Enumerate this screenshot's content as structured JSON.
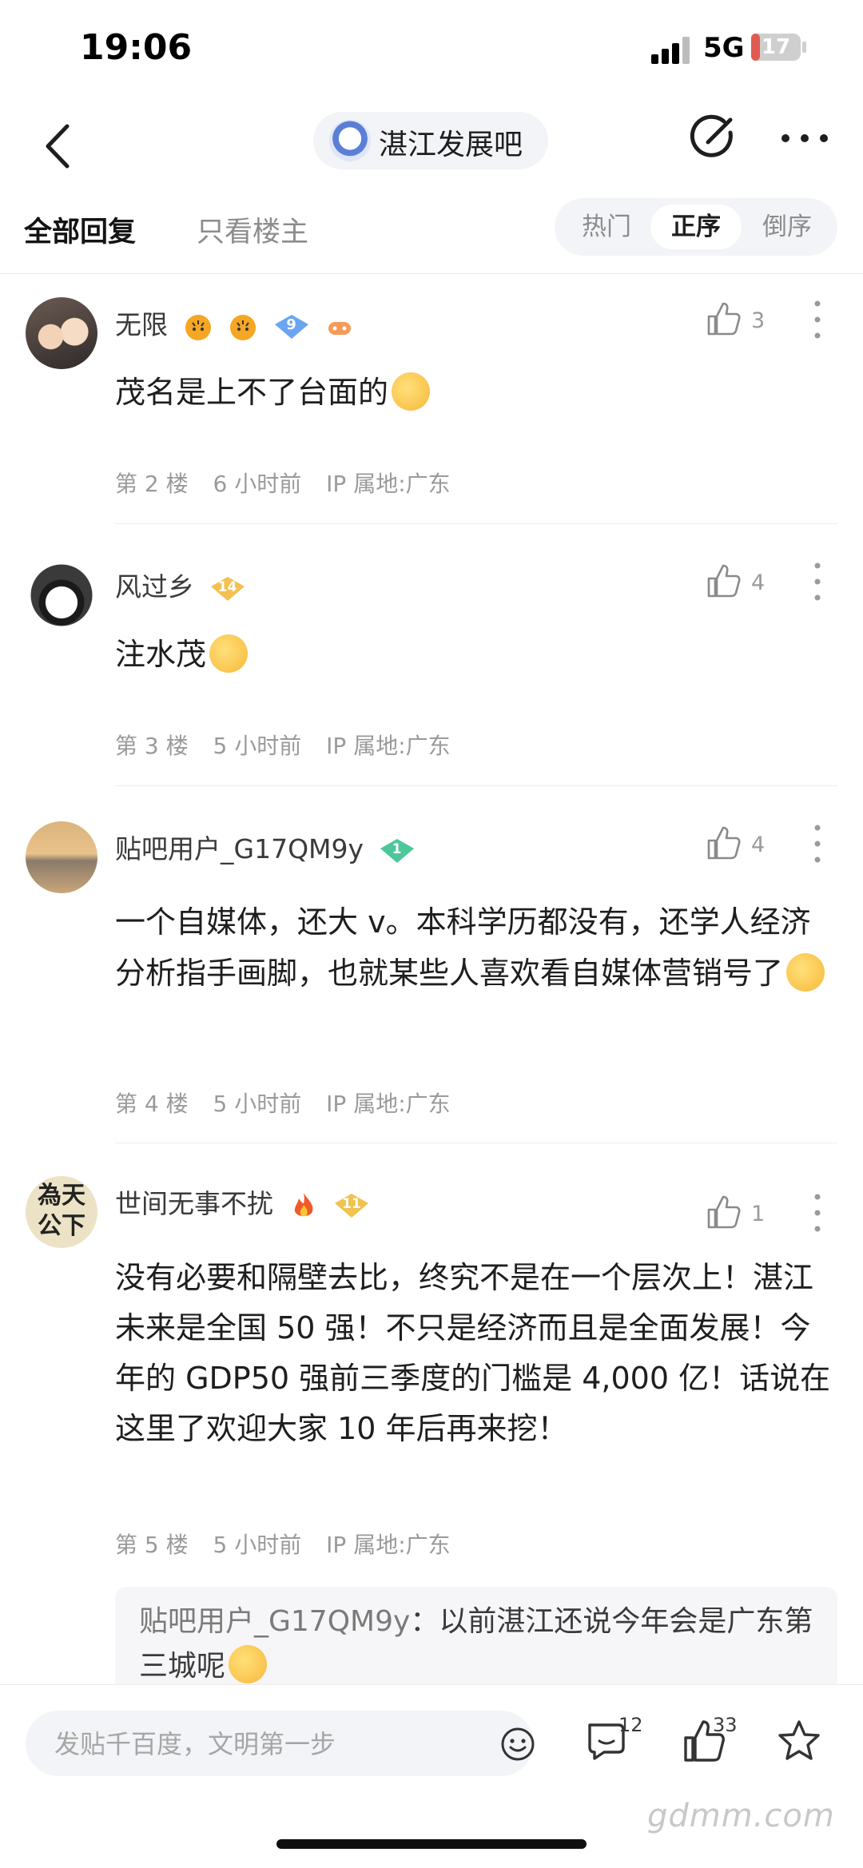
{
  "status_bar": {
    "time": "19:06",
    "network": "5G",
    "battery": "17",
    "battery_level": 0.17
  },
  "nav": {
    "forum_name": "湛江发展吧"
  },
  "tabs": {
    "all": "全部回复",
    "owner_only": "只看楼主"
  },
  "sort": {
    "hot": "热门",
    "asc": "正序",
    "desc": "倒序",
    "selected": "正序"
  },
  "posts": [
    {
      "username": "无限",
      "level": "9",
      "likes": "3",
      "content": "茂名是上不了台面的",
      "floor": "第 2 楼",
      "time": "6 小时前",
      "ip": "IP 属地:广东"
    },
    {
      "username": "风过乡",
      "level": "14",
      "likes": "4",
      "content": "注水茂",
      "floor": "第 3 楼",
      "time": "5 小时前",
      "ip": "IP 属地:广东"
    },
    {
      "username": "贴吧用户_G17QM9y",
      "level": "1",
      "likes": "4",
      "content": "一个自媒体，还大 v。本科学历都没有，还学人经济分析指手画脚，也就某些人喜欢看自媒体营销号了",
      "floor": "第 4 楼",
      "time": "5 小时前",
      "ip": "IP 属地:广东"
    },
    {
      "username": "世间无事不扰",
      "level": "11",
      "likes": "1",
      "content": "没有必要和隔壁去比，终究不是在一个层次上！湛江未来是全国 50 强！不只是经济而且是全面发展！今年的 GDP50 强前三季度的门槛是 4,000 亿！话说在这里了欢迎大家 10 年后再来挖！",
      "floor": "第 5 楼",
      "time": "5 小时前",
      "ip": "IP 属地:广东",
      "avatar_text": "為天公下",
      "reply": {
        "user": "贴吧用户_G17QM9y",
        "text": "：以前湛江还说今年会是广东第三城呢"
      }
    }
  ],
  "bottom_bar": {
    "input_placeholder": "发贴千百度，文明第一步",
    "comment_count": "12",
    "like_count": "33"
  },
  "watermark": "gdmm.com"
}
